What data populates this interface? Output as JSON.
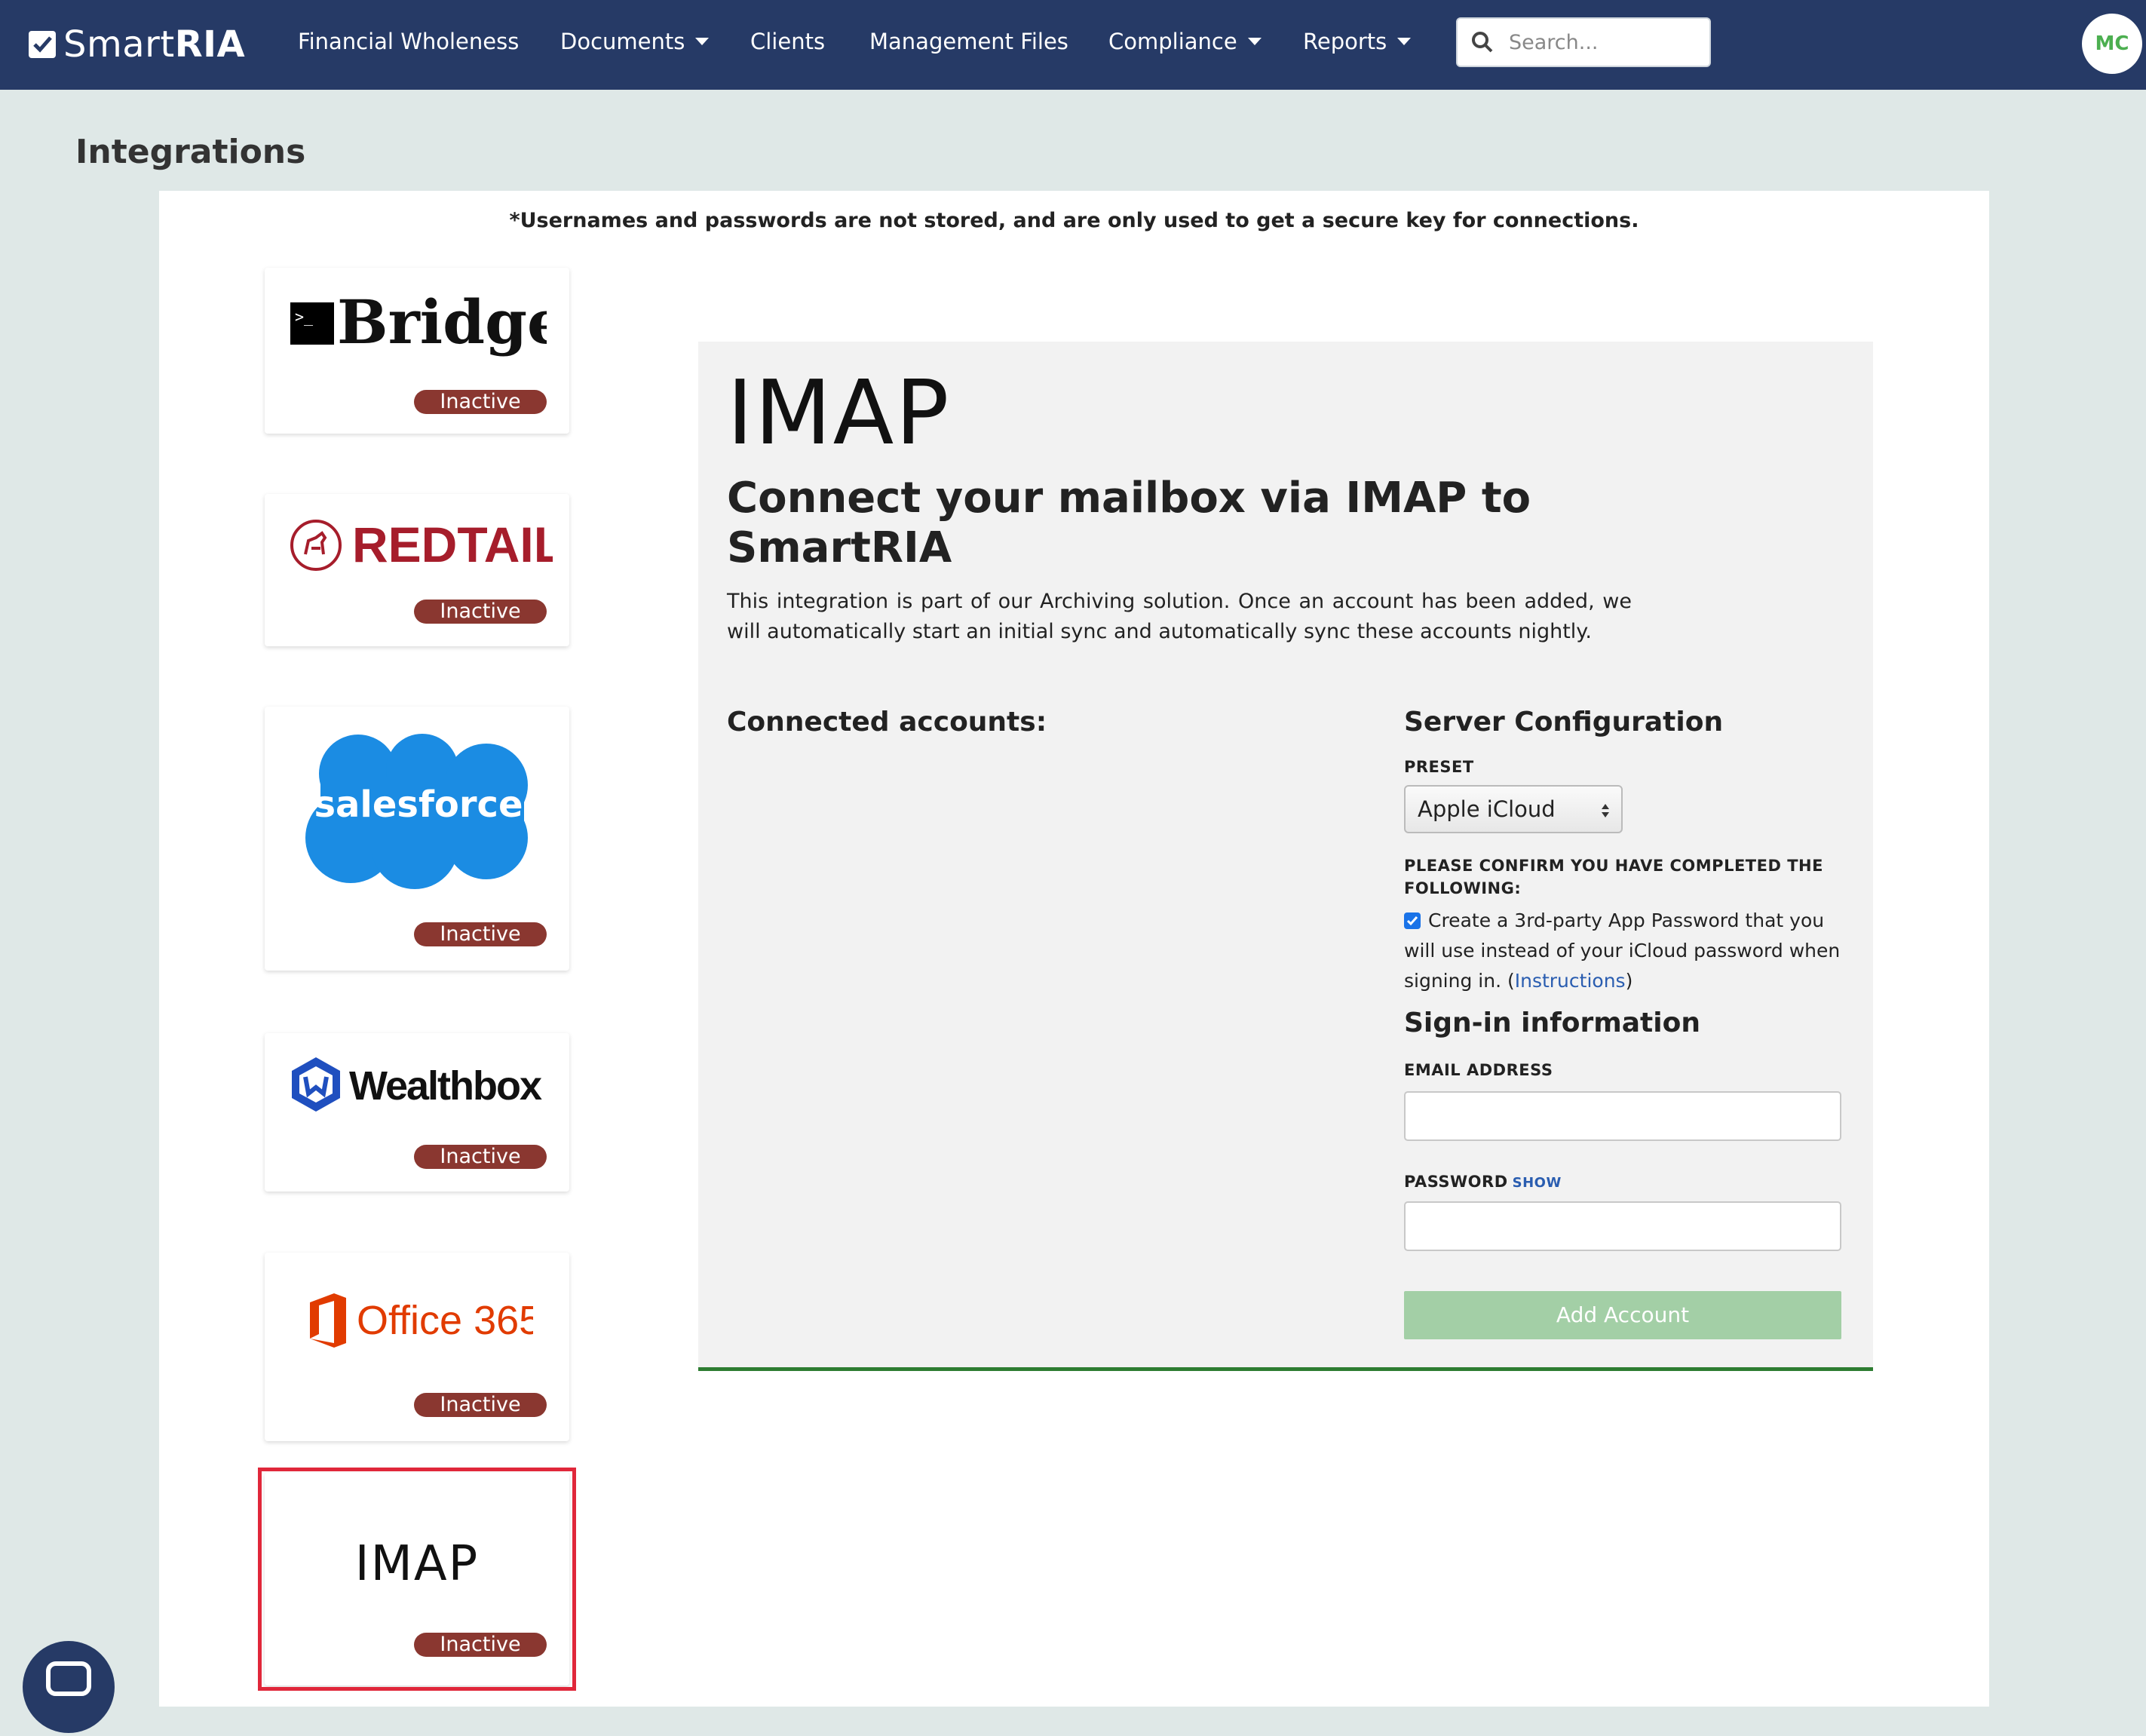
{
  "navbar": {
    "logo_text_light": "Smart",
    "logo_text_bold": "RIA",
    "items": [
      {
        "label": "Financial Wholeness",
        "dropdown": false
      },
      {
        "label": "Documents",
        "dropdown": true
      },
      {
        "label": "Clients",
        "dropdown": false
      },
      {
        "label": "Management Files",
        "dropdown": false
      },
      {
        "label": "Compliance",
        "dropdown": true
      },
      {
        "label": "Reports",
        "dropdown": true
      }
    ],
    "search_placeholder": "Search...",
    "avatar_initials": "MC",
    "background": "#263a66"
  },
  "page": {
    "title": "Integrations",
    "disclaimer": "*Usernames and passwords are not stored, and are only used to get a secure key for connections."
  },
  "integrations": [
    {
      "name": "Bridge",
      "status": "Inactive"
    },
    {
      "name": "REDTAIL",
      "status": "Inactive"
    },
    {
      "name": "salesforce",
      "status": "Inactive"
    },
    {
      "name": "Wealthbox",
      "status": "Inactive"
    },
    {
      "name": "Office 365",
      "status": "Inactive"
    },
    {
      "name": "IMAP",
      "status": "Inactive",
      "selected": true
    }
  ],
  "detail": {
    "title": "IMAP",
    "subtitle": "Connect your mailbox via IMAP to SmartRIA",
    "description": "This integration is part of our Archiving solution. Once an account has been added, we will automatically start an initial sync and automatically sync these accounts nightly.",
    "connected_accounts_label": "Connected accounts:",
    "server_config_label": "Server Configuration",
    "preset_label": "PRESET",
    "preset_value": "Apple iCloud",
    "confirm_label": "PLEASE CONFIRM YOU HAVE COMPLETED THE FOLLOWING:",
    "confirm_checked": true,
    "confirm_text": "Create a 3rd-party App Password that you will use instead of your iCloud password when signing in. (",
    "confirm_link": "Instructions",
    "confirm_text_end": ")",
    "signin_label": "Sign-in information",
    "email_label": "EMAIL ADDRESS",
    "email_value": "",
    "password_label": "PASSWORD",
    "password_show": "SHOW",
    "password_value": "",
    "add_button": "Add Account"
  },
  "colors": {
    "badge": "#8a3730",
    "selected_outline": "#e0273a",
    "accent_green": "#2e7d32",
    "button_disabled": "#a3cfa6"
  }
}
